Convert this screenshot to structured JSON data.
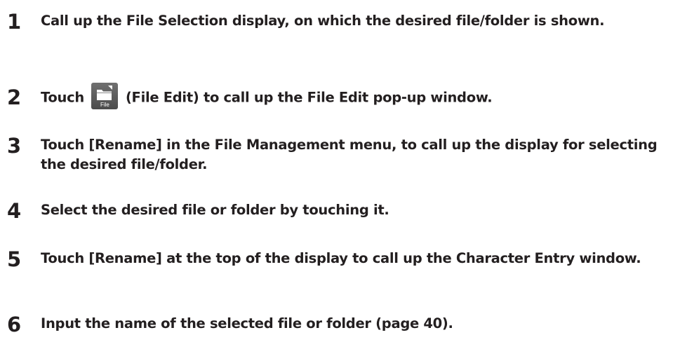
{
  "steps": [
    {
      "number": "1",
      "text": "Call up the File Selection display, on which the desired file/folder is shown."
    },
    {
      "number": "2",
      "text_before": "Touch",
      "icon_label": "File",
      "text_after": "(File Edit) to call up the File Edit pop-up window."
    },
    {
      "number": "3",
      "text": "Touch [Rename] in the File Management menu, to call up the display for selecting the desired file/folder."
    },
    {
      "number": "4",
      "text": "Select the desired file or folder by touching it."
    },
    {
      "number": "5",
      "text": "Touch [Rename] at the top of the display to call up the Character Entry window."
    },
    {
      "number": "6",
      "text": "Input the name of the selected file or folder (page 40)."
    }
  ],
  "icons": {
    "file_edit": "file-edit-icon"
  }
}
